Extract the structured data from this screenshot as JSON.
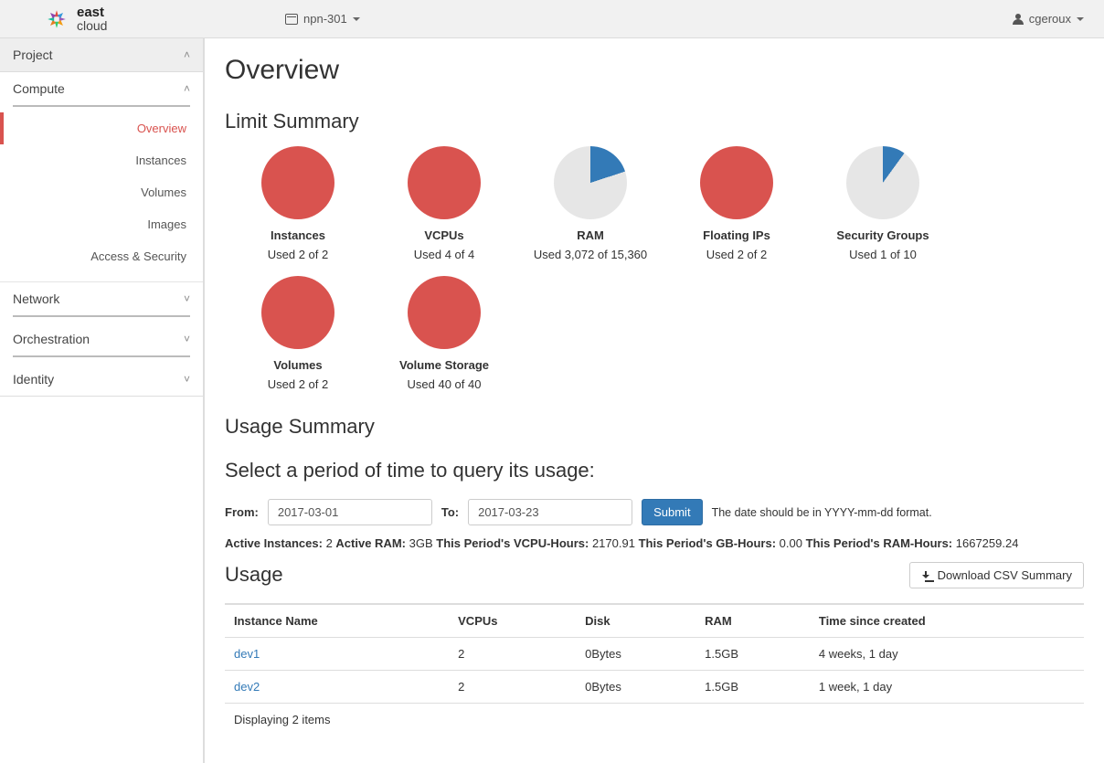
{
  "header": {
    "brand_top": "east",
    "brand_bottom": "cloud",
    "project": "npn-301",
    "user": "cgeroux"
  },
  "sidebar": {
    "project": "Project",
    "compute": "Compute",
    "items": [
      "Overview",
      "Instances",
      "Volumes",
      "Images",
      "Access & Security"
    ],
    "network": "Network",
    "orchestration": "Orchestration",
    "identity": "Identity"
  },
  "page": {
    "title": "Overview",
    "limit_summary": "Limit Summary",
    "usage_summary": "Usage Summary",
    "select_period": "Select a period of time to query its usage:",
    "from_label": "From:",
    "to_label": "To:",
    "from_value": "2017-03-01",
    "to_value": "2017-03-23",
    "submit": "Submit",
    "hint": "The date should be in YYYY-mm-dd format.",
    "usage_heading": "Usage",
    "download": "Download CSV Summary",
    "table_footer": "Displaying 2 items"
  },
  "limits": [
    {
      "label": "Instances",
      "used_text": "Used 2 of 2",
      "used": 2,
      "total": 2,
      "pct": 100
    },
    {
      "label": "VCPUs",
      "used_text": "Used 4 of 4",
      "used": 4,
      "total": 4,
      "pct": 100
    },
    {
      "label": "RAM",
      "used_text": "Used 3,072 of 15,360",
      "used": 3072,
      "total": 15360,
      "pct": 20
    },
    {
      "label": "Floating IPs",
      "used_text": "Used 2 of 2",
      "used": 2,
      "total": 2,
      "pct": 100
    },
    {
      "label": "Security Groups",
      "used_text": "Used 1 of 10",
      "used": 1,
      "total": 10,
      "pct": 10
    },
    {
      "label": "Volumes",
      "used_text": "Used 2 of 2",
      "used": 2,
      "total": 2,
      "pct": 100
    },
    {
      "label": "Volume Storage",
      "used_text": "Used 40 of 40",
      "used": 40,
      "total": 40,
      "pct": 100
    }
  ],
  "stats": {
    "active_instances_label": "Active Instances:",
    "active_instances": "2",
    "active_ram_label": "Active RAM:",
    "active_ram": "3GB",
    "vcpu_hours_label": "This Period's VCPU-Hours:",
    "vcpu_hours": "2170.91",
    "gb_hours_label": "This Period's GB-Hours:",
    "gb_hours": "0.00",
    "ram_hours_label": "This Period's RAM-Hours:",
    "ram_hours": "1667259.24"
  },
  "usage_table": {
    "headers": [
      "Instance Name",
      "VCPUs",
      "Disk",
      "RAM",
      "Time since created"
    ],
    "rows": [
      {
        "name": "dev1",
        "vcpus": "2",
        "disk": "0Bytes",
        "ram": "1.5GB",
        "time": "4 weeks, 1 day"
      },
      {
        "name": "dev2",
        "vcpus": "2",
        "disk": "0Bytes",
        "ram": "1.5GB",
        "time": "1 week, 1 day"
      }
    ]
  },
  "chart_data": [
    {
      "type": "pie",
      "title": "Instances",
      "categories": [
        "Used",
        "Free"
      ],
      "values": [
        2,
        0
      ],
      "used": 2,
      "total": 2
    },
    {
      "type": "pie",
      "title": "VCPUs",
      "categories": [
        "Used",
        "Free"
      ],
      "values": [
        4,
        0
      ],
      "used": 4,
      "total": 4
    },
    {
      "type": "pie",
      "title": "RAM",
      "categories": [
        "Used",
        "Free"
      ],
      "values": [
        3072,
        12288
      ],
      "used": 3072,
      "total": 15360
    },
    {
      "type": "pie",
      "title": "Floating IPs",
      "categories": [
        "Used",
        "Free"
      ],
      "values": [
        2,
        0
      ],
      "used": 2,
      "total": 2
    },
    {
      "type": "pie",
      "title": "Security Groups",
      "categories": [
        "Used",
        "Free"
      ],
      "values": [
        1,
        9
      ],
      "used": 1,
      "total": 10
    },
    {
      "type": "pie",
      "title": "Volumes",
      "categories": [
        "Used",
        "Free"
      ],
      "values": [
        2,
        0
      ],
      "used": 2,
      "total": 2
    },
    {
      "type": "pie",
      "title": "Volume Storage",
      "categories": [
        "Used",
        "Free"
      ],
      "values": [
        40,
        0
      ],
      "used": 40,
      "total": 40
    }
  ]
}
